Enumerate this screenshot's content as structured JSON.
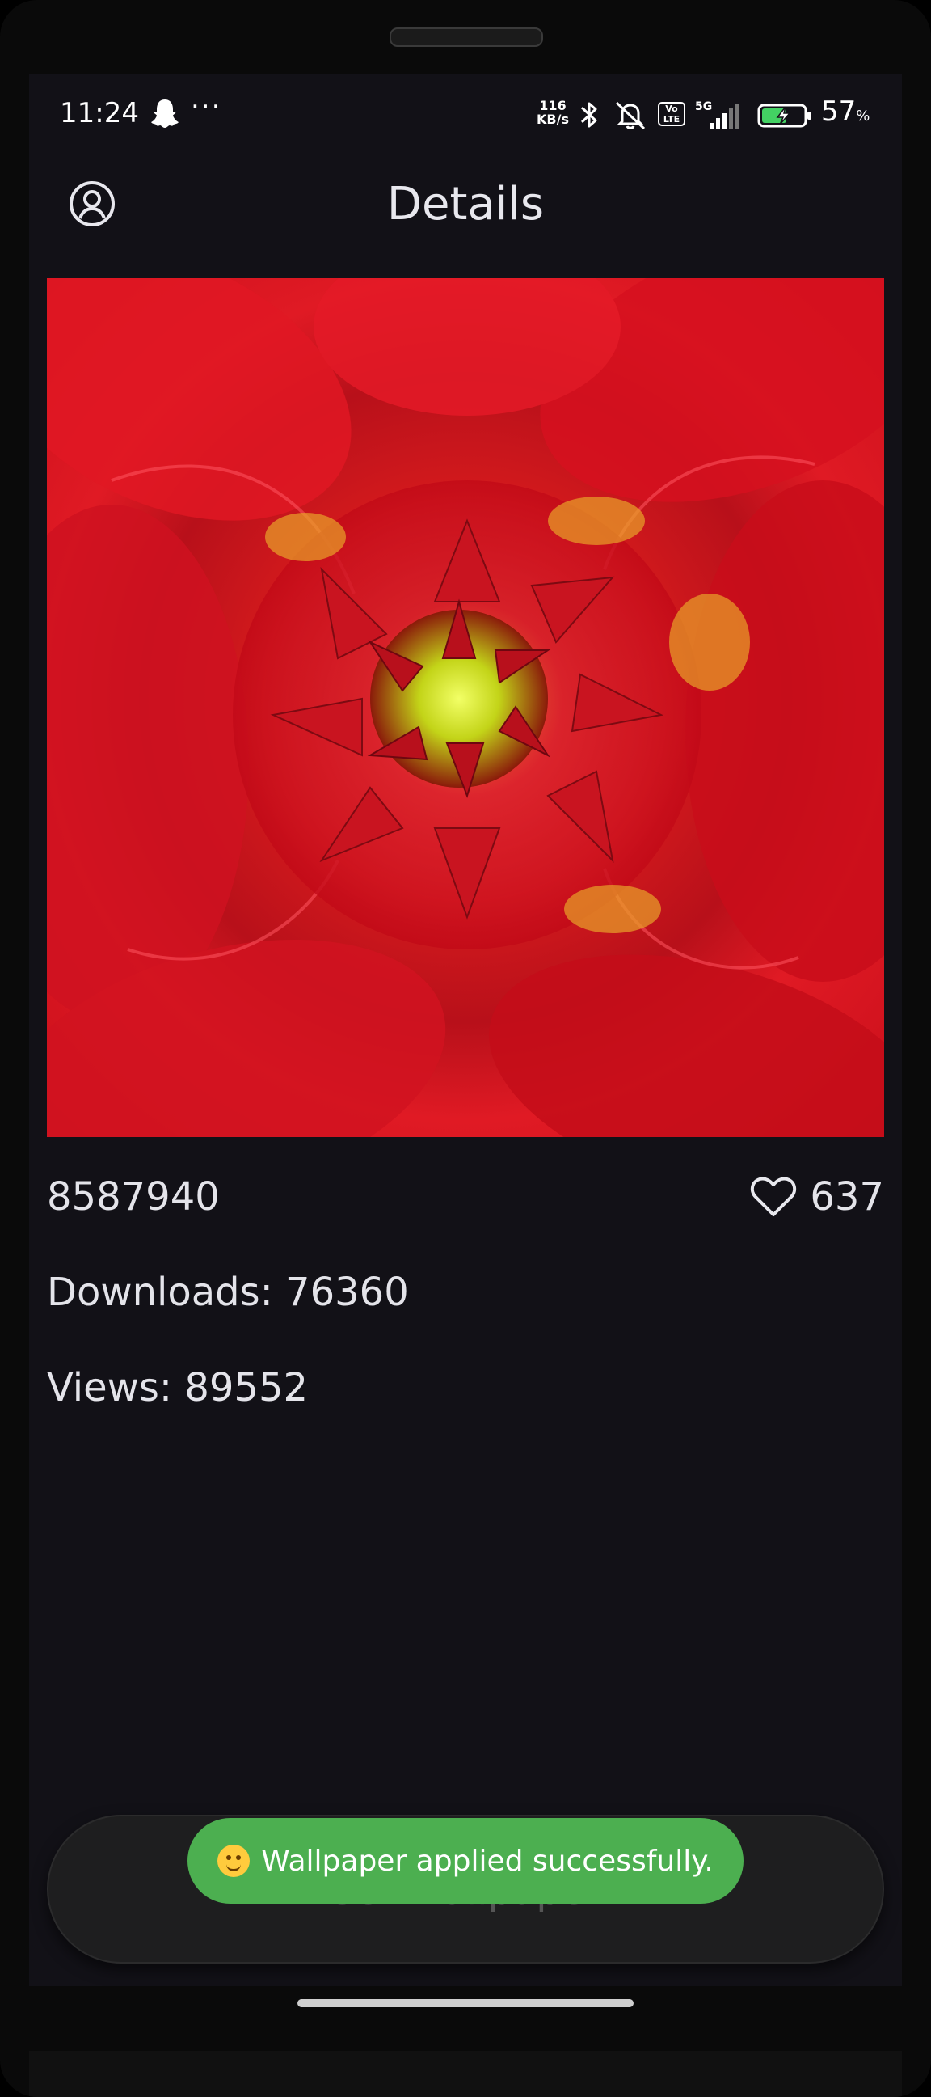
{
  "status_bar": {
    "time": "11:24",
    "more": "···",
    "net_speed_value": "116",
    "net_speed_unit": "KB/s",
    "volte_top": "Vo",
    "volte_bottom": "LTE",
    "network": "5G",
    "battery_percent": "57",
    "battery_percent_sign": "%"
  },
  "header": {
    "title": "Details"
  },
  "details": {
    "id": "8587940",
    "likes": "637",
    "downloads": "Downloads: 76360",
    "views": "Views: 89552"
  },
  "actions": {
    "set_wallpaper_label": "Set Wallpaper"
  },
  "toast": {
    "message": "Wallpaper applied successfully."
  },
  "colors": {
    "background": "#121117",
    "toast": "#4caf50",
    "text": "#e4e4ea"
  },
  "icons": {
    "profile": "profile-icon",
    "heart": "heart-icon",
    "bluetooth": "bluetooth-icon",
    "mute": "mute-icon",
    "battery": "battery-charging-icon"
  }
}
